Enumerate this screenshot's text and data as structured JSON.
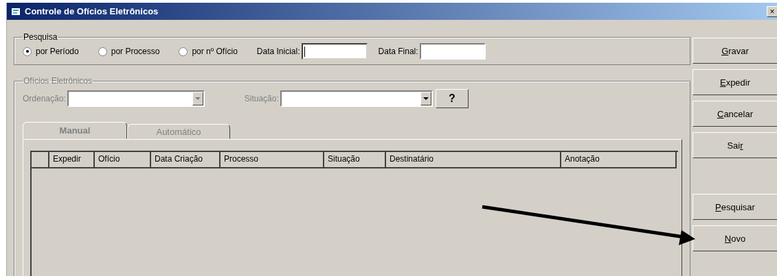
{
  "window": {
    "title": "Controle de Ofícios Eletrônicos",
    "close": "×"
  },
  "pesquisa": {
    "title": "Pesquisa",
    "options": [
      {
        "label": "por Período",
        "selected": true
      },
      {
        "label": "por Processo",
        "selected": false
      },
      {
        "label": "por nº Ofício",
        "selected": false
      }
    ],
    "fields": [
      {
        "label": "Data Inicial:",
        "focused": true
      },
      {
        "label": "Data Final:",
        "focused": false
      }
    ]
  },
  "oficios": {
    "title": "Ofícios Eletrônicos",
    "disabled": true,
    "ordenacao": {
      "label": "Ordenação:"
    },
    "situacao": {
      "label": "Situação:"
    },
    "help": "?",
    "tabs": [
      {
        "label": "Manual",
        "selected": true
      },
      {
        "label": "Automático",
        "selected": false
      }
    ],
    "columns": [
      "Expedir",
      "Ofício",
      "Data Criação",
      "Processo",
      "Situação",
      "Destinatário",
      "Anotação"
    ]
  },
  "buttons": [
    {
      "key": "G",
      "post": "ravar"
    },
    {
      "key": "E",
      "post": "xpedir"
    },
    {
      "key": "C",
      "post": "ancelar"
    },
    {
      "pre": "Sai",
      "key": "r"
    },
    {
      "key": "P",
      "post": "esquisar"
    },
    {
      "key": "N",
      "post": "ovo"
    }
  ]
}
